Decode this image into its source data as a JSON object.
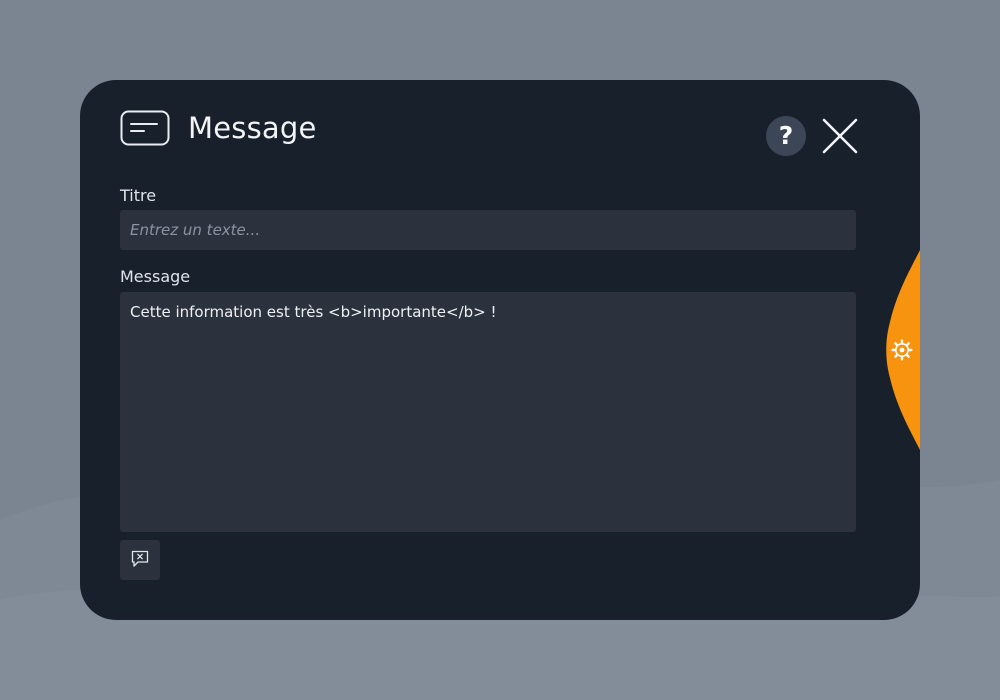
{
  "dialog": {
    "title": "Message",
    "icons": {
      "title": "message-card-icon",
      "help": "help-icon",
      "close": "close-icon",
      "clear": "clear-message-icon",
      "settings": "gear-icon"
    },
    "help_label": "?"
  },
  "fields": {
    "title": {
      "label": "Titre",
      "placeholder": "Entrez un texte...",
      "value": ""
    },
    "message": {
      "label": "Message",
      "value": "Cette information est très <b>importante</b> !"
    }
  },
  "colors": {
    "background": "#7b8591",
    "dialog": "#18202c",
    "field": "#2b313d",
    "accent": "#f7930e",
    "help_button": "#3d4656"
  }
}
